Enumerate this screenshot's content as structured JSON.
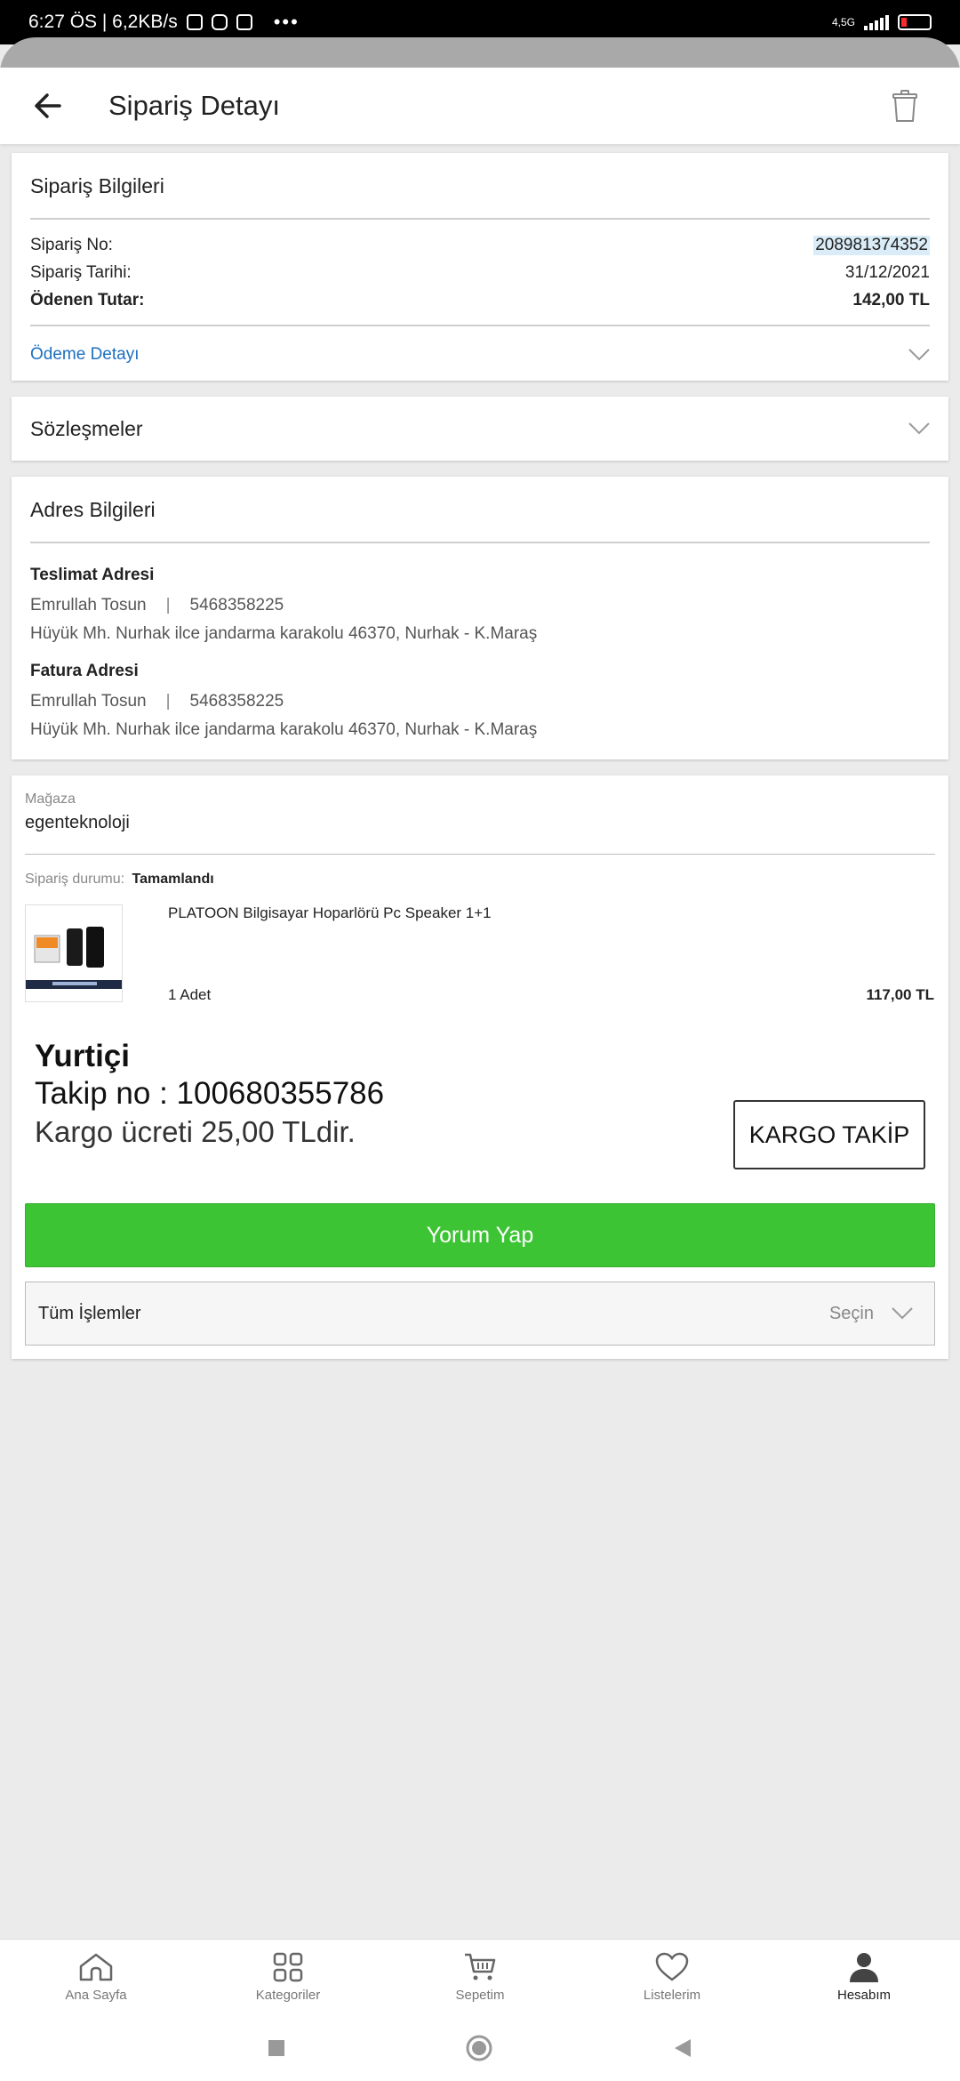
{
  "status_bar": {
    "time_speed": "6:27 ÖS | 6,2KB/s",
    "dots": "•••",
    "network": "4,5G"
  },
  "header": {
    "title": "Sipariş Detayı"
  },
  "order_info": {
    "title": "Sipariş Bilgileri",
    "order_no_label": "Sipariş No:",
    "order_no": "208981374352",
    "order_date_label": "Sipariş Tarihi:",
    "order_date": "31/12/2021",
    "paid_label": "Ödenen Tutar:",
    "paid_amount": "142,00 TL",
    "payment_detail": "Ödeme Detayı"
  },
  "agreements": {
    "title": "Sözleşmeler"
  },
  "address": {
    "title": "Adres Bilgileri",
    "delivery_title": "Teslimat Adresi",
    "delivery_name": "Emrullah Tosun",
    "delivery_sep": "|",
    "delivery_phone": "5468358225",
    "delivery_line": "Hüyük Mh.  Nurhak ilce jandarma karakolu 46370, Nurhak - K.Maraş",
    "invoice_title": "Fatura Adresi",
    "invoice_name": "Emrullah Tosun",
    "invoice_sep": "|",
    "invoice_phone": "5468358225",
    "invoice_line": "Hüyük Mh.  Nurhak ilce jandarma karakolu 46370, Nurhak - K.Maraş"
  },
  "store": {
    "label": "Mağaza",
    "name": "egenteknoloji",
    "status_label": "Sipariş durumu:",
    "status": "Tamamlandı",
    "product_name": "PLATOON Bilgisayar Hoparlörü Pc Speaker 1+1",
    "quantity": "1 Adet",
    "price": "117,00 TL",
    "carrier": "Yurtiçi",
    "tracking": "Takip no : 100680355786",
    "shipping_fee": "Kargo ücreti 25,00 TLdir.",
    "track_button": "KARGO TAKİP",
    "comment_button": "Yorum Yap",
    "actions_label": "Tüm İşlemler",
    "actions_value": "Seçin"
  },
  "bottom_nav": {
    "items": [
      {
        "label": "Ana Sayfa",
        "icon": "home-icon"
      },
      {
        "label": "Kategoriler",
        "icon": "grid-icon"
      },
      {
        "label": "Sepetim",
        "icon": "cart-icon"
      },
      {
        "label": "Listelerim",
        "icon": "heart-icon"
      },
      {
        "label": "Hesabım",
        "icon": "user-icon",
        "active": true
      }
    ]
  },
  "colors": {
    "accent_link": "#1d6fbf",
    "primary_button": "#3dc434",
    "background": "#ebebeb"
  }
}
